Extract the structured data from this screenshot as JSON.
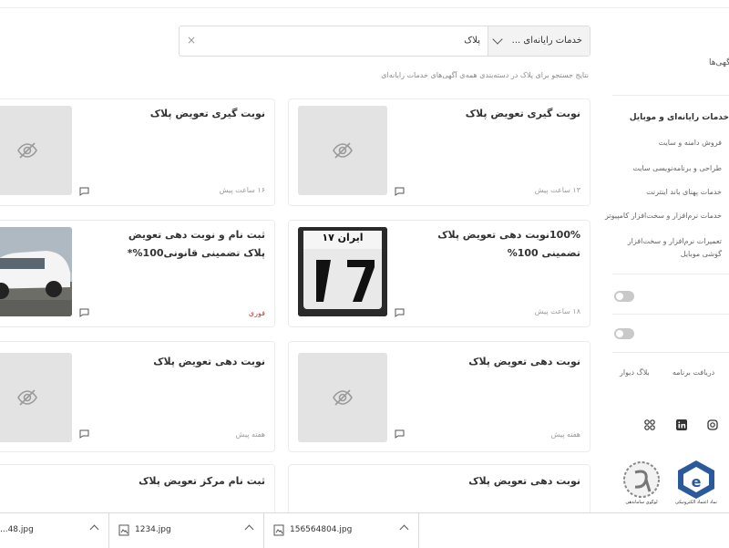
{
  "search": {
    "category_label": "خدمات رایانه‌ای ...",
    "query": "پلاک"
  },
  "results_note": "نتایج جستجو برای پلاک در دسته‌بندی همه‌ی آگهی‌های خدمات رایانه‌ای",
  "cards": [
    {
      "title": "نوبت گیری تعویض پلاک",
      "meta": "۱۳ ساعت پیش",
      "urgent": "",
      "image": "placeholder"
    },
    {
      "title": "نوبت گیری تعویض پلاک",
      "meta": "۱۶ ساعت پیش",
      "urgent": "",
      "image": "placeholder"
    },
    {
      "title": "100%نوبت دهی تعویض پلاک تضمینی 100%",
      "meta": "۱۸ ساعت پیش",
      "urgent": "",
      "image": "plate",
      "plate_text": "ایران ۱۷"
    },
    {
      "title": "ثبت نام و نوبت دهی تعویض پلاک تضمینی قانونی100%*",
      "meta": "",
      "urgent": "فوری",
      "image": "car"
    },
    {
      "title": "نوبت دهی تعویض پلاک",
      "meta": "هفته پیش",
      "urgent": "",
      "image": "placeholder"
    },
    {
      "title": "نوبت دهی تعویض پلاک",
      "meta": "هفته پیش",
      "urgent": "",
      "image": "placeholder"
    },
    {
      "title": "نوبت دهی تعویض پلاک",
      "meta": "",
      "urgent": "",
      "image": "placeholder"
    },
    {
      "title": "ثبت نام مرکز تعویض پلاک",
      "meta": "",
      "urgent": "",
      "image": "placeholder"
    }
  ],
  "sidebar": {
    "ads_label": "آگهی‌ها",
    "category_title": "خدمات رایانه‌ای و موبایل",
    "items": [
      "فروش دامنه و سایت",
      "طراحی و برنامه‌نویسی سایت",
      "خدمات پهنای باند اینترنت",
      "خدمات نرم‌افزار و سخت‌افزار کامپیوتر",
      "تعمیرات نرم‌افزار و سخت‌افزار گوشی موبایل"
    ],
    "link_download": "دریافت برنامه",
    "link_blog": "بلاگ دیوار",
    "badge_left_text": "لوگوی ساماندهی",
    "badge_right_text": "نماد اعتماد الکترونیکی"
  },
  "downloads": [
    {
      "name": "...48.jpg"
    },
    {
      "name": "1234.jpg"
    },
    {
      "name": "156564804.jpg"
    }
  ],
  "colors": {
    "urgent": "#c0392b",
    "toggle_off": "#c9c9c9",
    "thumb_bg": "#e3e3e3"
  }
}
